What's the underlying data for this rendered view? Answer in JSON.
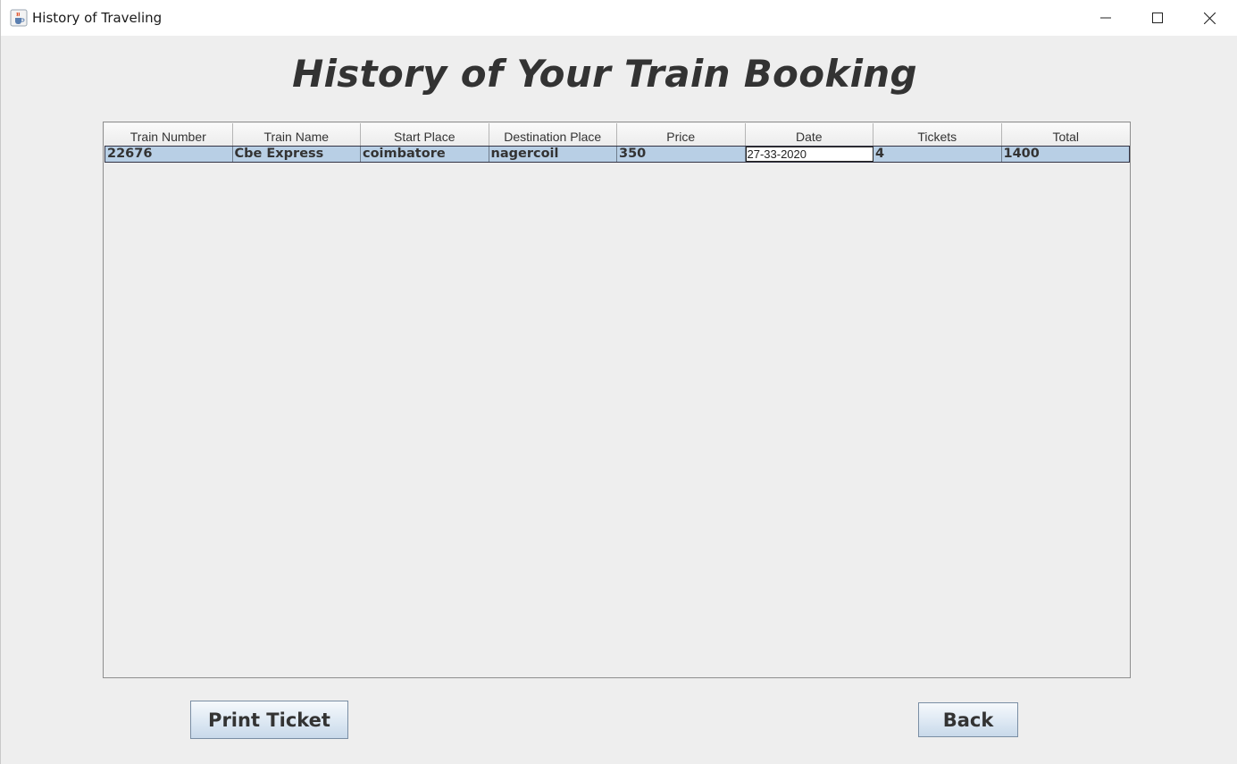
{
  "window": {
    "title": "History of Traveling",
    "icon": "java-cup-icon"
  },
  "heading": "History of Your Train Booking",
  "table": {
    "columns": [
      "Train Number",
      "Train Name",
      "Start Place",
      "Destination Place",
      "Price",
      "Date",
      "Tickets",
      "Total"
    ],
    "rows": [
      [
        "22676",
        "Cbe Express",
        "coimbatore",
        "nagercoil",
        "350",
        "27-33-2020",
        "4",
        "1400"
      ]
    ],
    "selected_row_color": "#b8cfe5"
  },
  "buttons": {
    "print_label": "Print Ticket",
    "back_label": "Back"
  }
}
